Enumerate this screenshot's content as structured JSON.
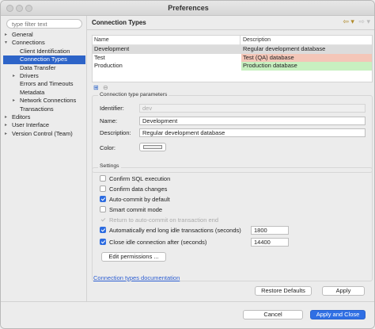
{
  "window": {
    "title": "Preferences"
  },
  "sidebar": {
    "filter_placeholder": "type filter text",
    "items": [
      {
        "label": "General",
        "expander": "▸"
      },
      {
        "label": "Connections",
        "expander": "▾"
      },
      {
        "label": "Client Identification",
        "expander": ""
      },
      {
        "label": "Connection Types",
        "expander": "",
        "selected": true
      },
      {
        "label": "Data Transfer",
        "expander": ""
      },
      {
        "label": "Drivers",
        "expander": "▸"
      },
      {
        "label": "Errors and Timeouts",
        "expander": ""
      },
      {
        "label": "Metadata",
        "expander": ""
      },
      {
        "label": "Network Connections",
        "expander": "▸"
      },
      {
        "label": "Transactions",
        "expander": ""
      },
      {
        "label": "Editors",
        "expander": "▸"
      },
      {
        "label": "User Interface",
        "expander": "▸"
      },
      {
        "label": "Version Control (Team)",
        "expander": "▸"
      }
    ]
  },
  "panel": {
    "title": "Connection Types",
    "nav": {
      "back_icon": "arrow-left-icon",
      "forward_icon": "arrow-right-icon",
      "back": "⇦ ▾",
      "forward": "⇨ ▾"
    },
    "table": {
      "headers": {
        "name": "Name",
        "description": "Description"
      },
      "rows": [
        {
          "name": "Development",
          "description": "Regular development database",
          "color": "#dcdcdc"
        },
        {
          "name": "Test",
          "description": "Test (QA) database",
          "color": "#f4c6b8"
        },
        {
          "name": "Production",
          "description": "Production database",
          "color": "#c8f0c0"
        }
      ]
    },
    "params": {
      "group_label": "Connection type parameters",
      "identifier_label": "Identifier:",
      "identifier_value": "dev",
      "name_label": "Name:",
      "name_value": "Development",
      "description_label": "Description:",
      "description_value": "Regular development database",
      "color_label": "Color:",
      "color_value": "#ececec"
    },
    "settings": {
      "group_label": "Settings",
      "checkboxes": [
        {
          "label": "Confirm SQL execution",
          "checked": false,
          "enabled": true
        },
        {
          "label": "Confirm data changes",
          "checked": false,
          "enabled": true
        },
        {
          "label": "Auto-commit by default",
          "checked": true,
          "enabled": true
        },
        {
          "label": "Smart commit mode",
          "checked": false,
          "enabled": true
        },
        {
          "label": "Return to auto-commit on transaction end",
          "checked": true,
          "enabled": false
        },
        {
          "label": "Automatically end long idle transactions (seconds)",
          "checked": true,
          "enabled": true,
          "value": "1800"
        },
        {
          "label": "Close idle connection after (seconds)",
          "checked": true,
          "enabled": true,
          "value": "14400"
        }
      ],
      "edit_permissions_label": "Edit permissions ..."
    },
    "doc_link": "Connection types documentation",
    "restore_defaults_label": "Restore Defaults",
    "apply_label": "Apply"
  },
  "footer": {
    "cancel_label": "Cancel",
    "apply_close_label": "Apply and Close"
  }
}
